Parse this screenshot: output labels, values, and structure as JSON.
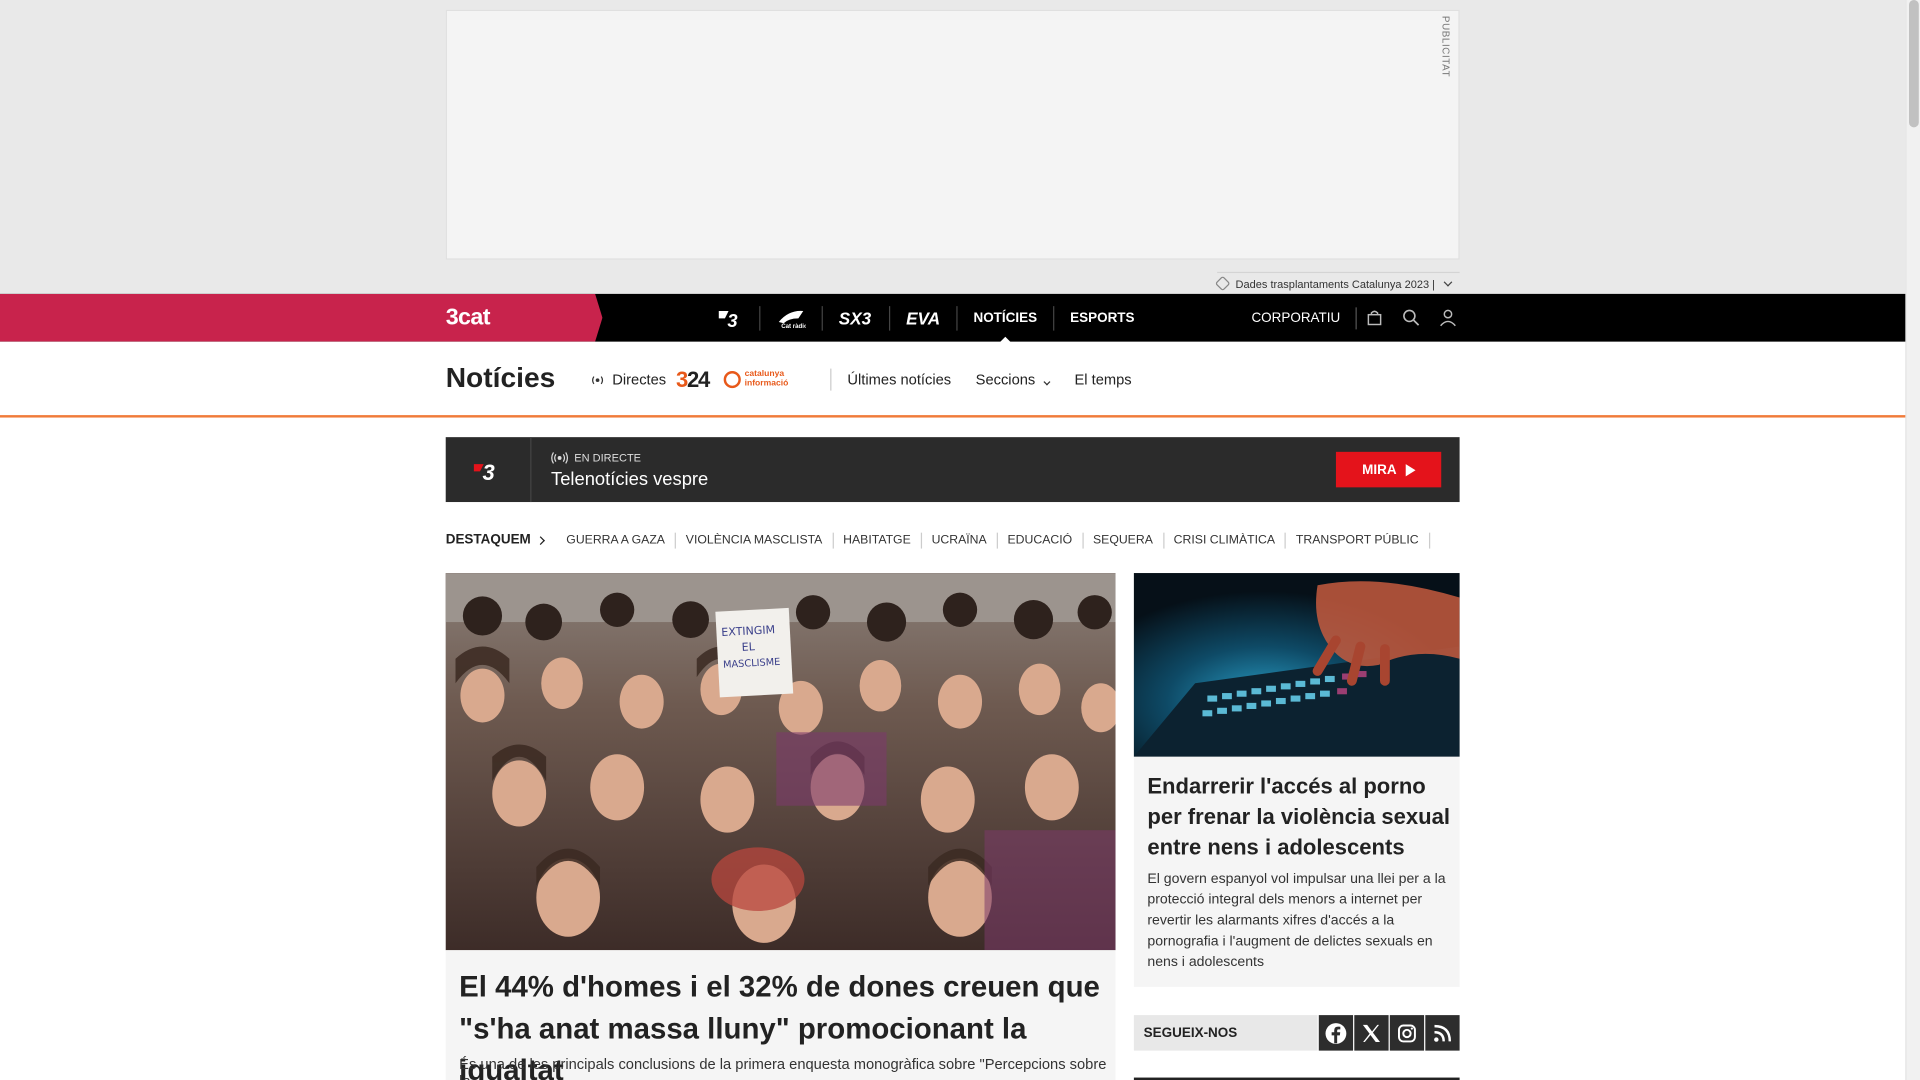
{
  "ad": {
    "label": "PUBLICITAT",
    "caption": "Dades trasplantaments Catalunya 2023 |"
  },
  "topnav": {
    "brand": "3cat",
    "channels": [
      {
        "label": "3",
        "icon": "tv3-logo"
      },
      {
        "label": "Cat ràdio",
        "icon": "catradio-logo"
      },
      {
        "label": "SX3",
        "icon": "sx3-logo"
      },
      {
        "label": "EVA",
        "icon": "eva-logo"
      },
      {
        "label": "NOTÍCIES",
        "active": true
      },
      {
        "label": "ESPORTS"
      }
    ],
    "corporate": "CORPORATIU",
    "icons": [
      "shopping-bag-icon",
      "search-icon",
      "user-icon"
    ]
  },
  "section": {
    "title": "Notícies",
    "directes": "Directes",
    "logo_324": "324",
    "logo_ci": "catalunya informació",
    "links": [
      "Últimes notícies",
      "Seccions",
      "El temps"
    ]
  },
  "live": {
    "channel": "3",
    "tag": "EN DIRECTE",
    "title": "Telenotícies vespre",
    "button": "MIRA"
  },
  "destaquem": {
    "label": "DESTAQUEM",
    "items": [
      "GUERRA A GAZA",
      "VIOLÈNCIA MASCLISTA",
      "HABITATGE",
      "UCRAÏNA",
      "EDUCACIÓ",
      "SEQUERA",
      "CRISI CLIMÀTICA",
      "TRANSPORT PÚBLIC"
    ]
  },
  "main_article": {
    "sign_text": "EXTINGIM EL MASCLISME",
    "title": "El 44% d'homes i el 32% de dones creuen que \"s'ha anat massa lluny\" promocionant la igualtat",
    "description": "És una de les principals conclusions de la primera enquesta monogràfica sobre \"Percepcions sobre la"
  },
  "side_article": {
    "title": "Endarrerir l'accés al porno per frenar la violència sexual entre nens i adolescents",
    "description": "El govern espanyol vol impulsar una llei per a la protecció integral dels menors a internet per revertir les alarmants xifres d'accés a la pornografia i l'augment de delictes sexuals en nens i adolescents"
  },
  "follow": {
    "label": "SEGUEIX-NOS",
    "networks": [
      "facebook-icon",
      "x-icon",
      "instagram-icon",
      "rss-icon"
    ]
  },
  "colors": {
    "brand": "#c8234c",
    "accent_orange": "#f07b3a",
    "live_red": "#e4131b"
  }
}
